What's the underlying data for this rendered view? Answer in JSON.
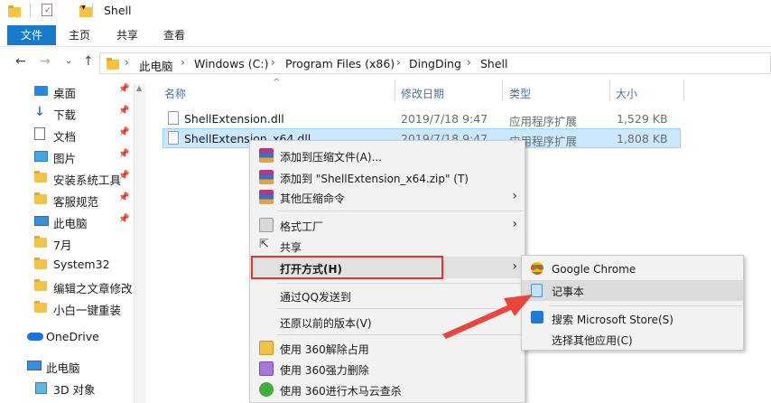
{
  "window": {
    "title": "Shell"
  },
  "ribbon": {
    "tabs": [
      "文件",
      "主页",
      "共享",
      "查看"
    ]
  },
  "address": {
    "crumbs": [
      "此电脑",
      "Windows (C:)",
      "Program Files (x86)",
      "DingDing",
      "Shell"
    ]
  },
  "nav": {
    "items": [
      {
        "label": "桌面",
        "icon": "desktop-icon",
        "pinned": true
      },
      {
        "label": "下载",
        "icon": "download-icon",
        "pinned": true
      },
      {
        "label": "文档",
        "icon": "document-icon",
        "pinned": true
      },
      {
        "label": "图片",
        "icon": "picture-icon",
        "pinned": true
      },
      {
        "label": "安装系统工具",
        "icon": "folder-icon",
        "pinned": true
      },
      {
        "label": "客服规范",
        "icon": "folder-icon",
        "pinned": true
      },
      {
        "label": "此电脑",
        "icon": "computer-icon",
        "pinned": true
      },
      {
        "label": "7月",
        "icon": "folder-icon",
        "pinned": false
      },
      {
        "label": "System32",
        "icon": "folder-icon",
        "pinned": false
      },
      {
        "label": "编辑之文章修改",
        "icon": "folder-icon",
        "pinned": false
      },
      {
        "label": "小白一键重装",
        "icon": "folder-icon",
        "pinned": false
      },
      {
        "label": "OneDrive",
        "icon": "onedrive-icon",
        "pinned": false
      },
      {
        "label": "此电脑",
        "icon": "computer-icon",
        "pinned": false
      },
      {
        "label": "3D 对象",
        "icon": "3d-objects-icon",
        "pinned": false
      }
    ]
  },
  "files": {
    "columns": [
      "名称",
      "修改日期",
      "类型",
      "大小"
    ],
    "rows": [
      {
        "name": "ShellExtension.dll",
        "date": "2019/7/18 9:47",
        "type": "应用程序扩展",
        "size": "1,529 KB",
        "selected": false
      },
      {
        "name": "ShellExtension_x64.dll",
        "date": "2019/7/18 9:47",
        "type": "应用程序扩展",
        "size": "1,808 KB",
        "selected": true
      }
    ]
  },
  "context_menu": {
    "items": [
      "添加到压缩文件(A)...",
      "添加到 \"ShellExtension_x64.zip\" (T)",
      "其他压缩命令",
      "格式工厂",
      "共享",
      "打开方式(H)",
      "通过QQ发送到",
      "还原以前的版本(V)",
      "使用 360解除占用",
      "使用 360强力删除",
      "使用 360进行木马云查杀"
    ]
  },
  "submenu": {
    "items": [
      "Google Chrome",
      "记事本",
      "搜索 Microsoft Store(S)",
      "选择其他应用(C)"
    ]
  },
  "colors": {
    "accent": "#1979ca",
    "highlight_box": "#e0342c",
    "arrow": "#e8453c",
    "selection": "#cce8ff"
  }
}
